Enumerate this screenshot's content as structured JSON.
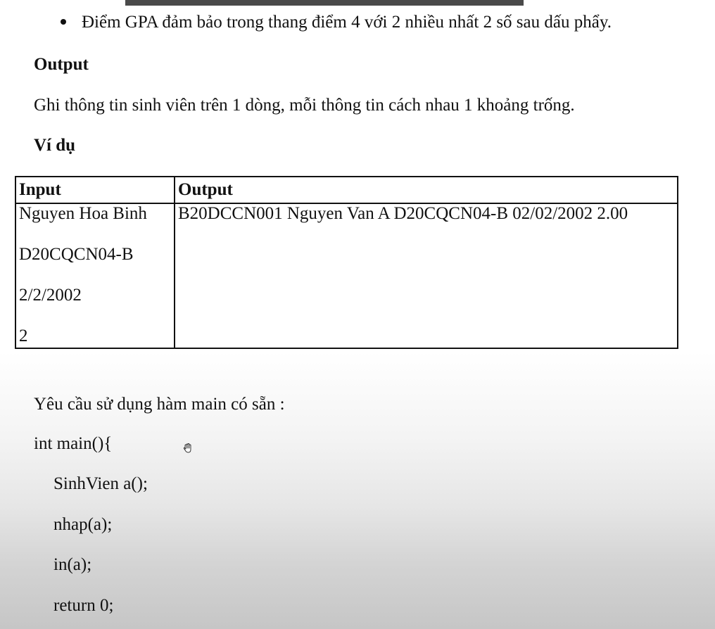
{
  "bullet": {
    "text": "Điểm GPA đảm bảo trong thang điểm 4 với 2 nhiều nhất 2 số sau dấu phẩy."
  },
  "output_section": {
    "heading": "Output",
    "description": "Ghi thông tin sinh viên trên 1 dòng, mỗi thông tin cách nhau 1 khoảng trống."
  },
  "example_section": {
    "heading": "Ví dụ",
    "table": {
      "headers": [
        "Input",
        "Output"
      ],
      "input_lines": [
        "Nguyen Hoa Binh",
        "D20CQCN04-B",
        "2/2/2002",
        "2"
      ],
      "output_lines": [
        "B20DCCN001 Nguyen Van A D20CQCN04-B 02/02/2002 2.00"
      ]
    }
  },
  "requirement": {
    "text": "Yêu cầu sử dụng hàm main có sẵn :",
    "code_lines": [
      "int main(){",
      "SinhVien a();",
      "nhap(a);",
      "in(a);",
      "return 0;"
    ]
  },
  "icons": {
    "cursor": "hand-cursor-icon"
  }
}
